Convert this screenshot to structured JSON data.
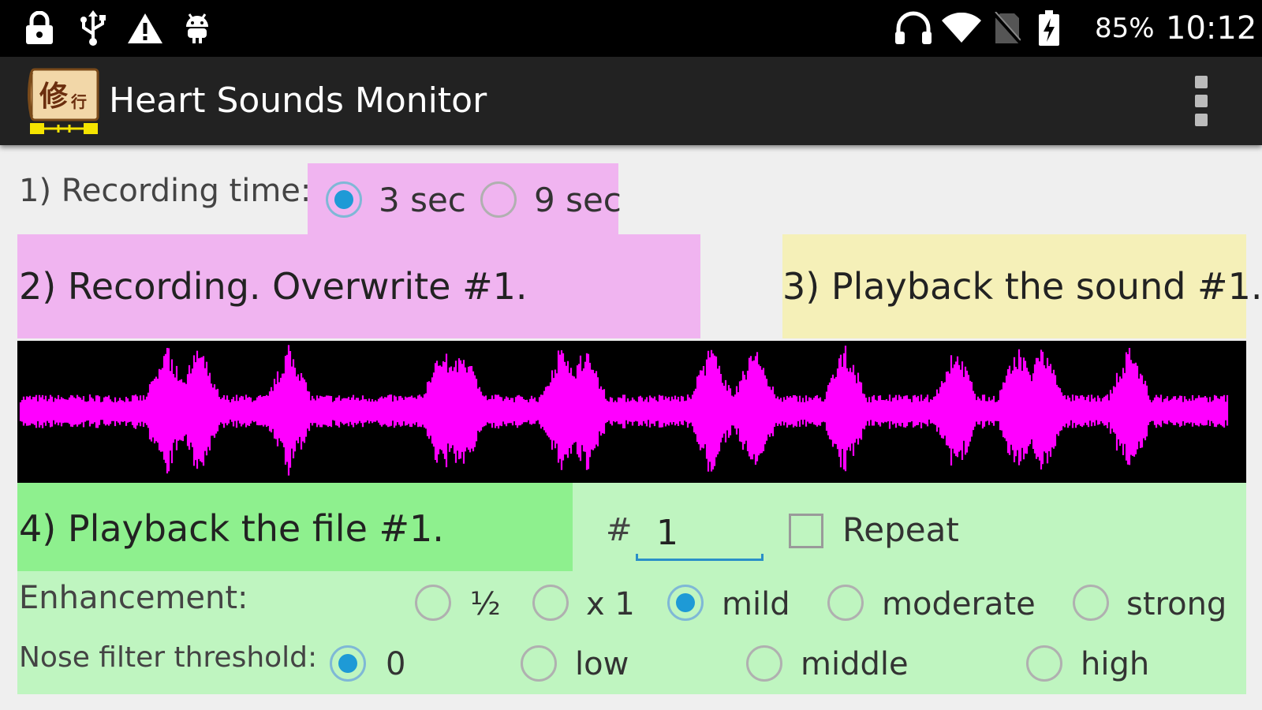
{
  "status_bar": {
    "battery_percent": "85%",
    "time": "10:12",
    "left_icons": [
      "lock-icon",
      "usb-icon",
      "warning-icon",
      "android-icon"
    ],
    "right_icons": [
      "headphones-icon",
      "wifi-icon",
      "no-sim-icon",
      "battery-charging-icon"
    ]
  },
  "action_bar": {
    "title": "Heart Sounds Monitor",
    "logo_text": "修行",
    "menu_icon": "overflow-menu-icon"
  },
  "recording_time": {
    "label": "1) Recording time:",
    "options": [
      "3 sec",
      "9 sec"
    ],
    "selected": "3 sec"
  },
  "record_button": {
    "label": "2) Recording. Overwrite #1."
  },
  "playback_sound_button": {
    "label": "3) Playback the sound #1."
  },
  "playback_file_button": {
    "label": "4) Playback the file #1."
  },
  "file_number": {
    "hash": "#",
    "value": "1"
  },
  "repeat": {
    "label": "Repeat",
    "checked": false
  },
  "enhancement": {
    "label": "Enhancement:",
    "options": [
      "½",
      "x 1",
      "mild",
      "moderate",
      "strong"
    ],
    "selected": "mild"
  },
  "noise_filter": {
    "label": "Nose filter threshold:",
    "options": [
      "0",
      "low",
      "middle",
      "high"
    ],
    "selected": "0"
  },
  "colors": {
    "waveform": "#ff00ff",
    "waveform_bg": "#000000",
    "pink_panel": "#f0b4f0",
    "yellow_panel": "#f5f0b8",
    "green_dark": "#8ef08e",
    "green_light": "#bff5c0",
    "radio_accent": "#1e9ad6"
  }
}
